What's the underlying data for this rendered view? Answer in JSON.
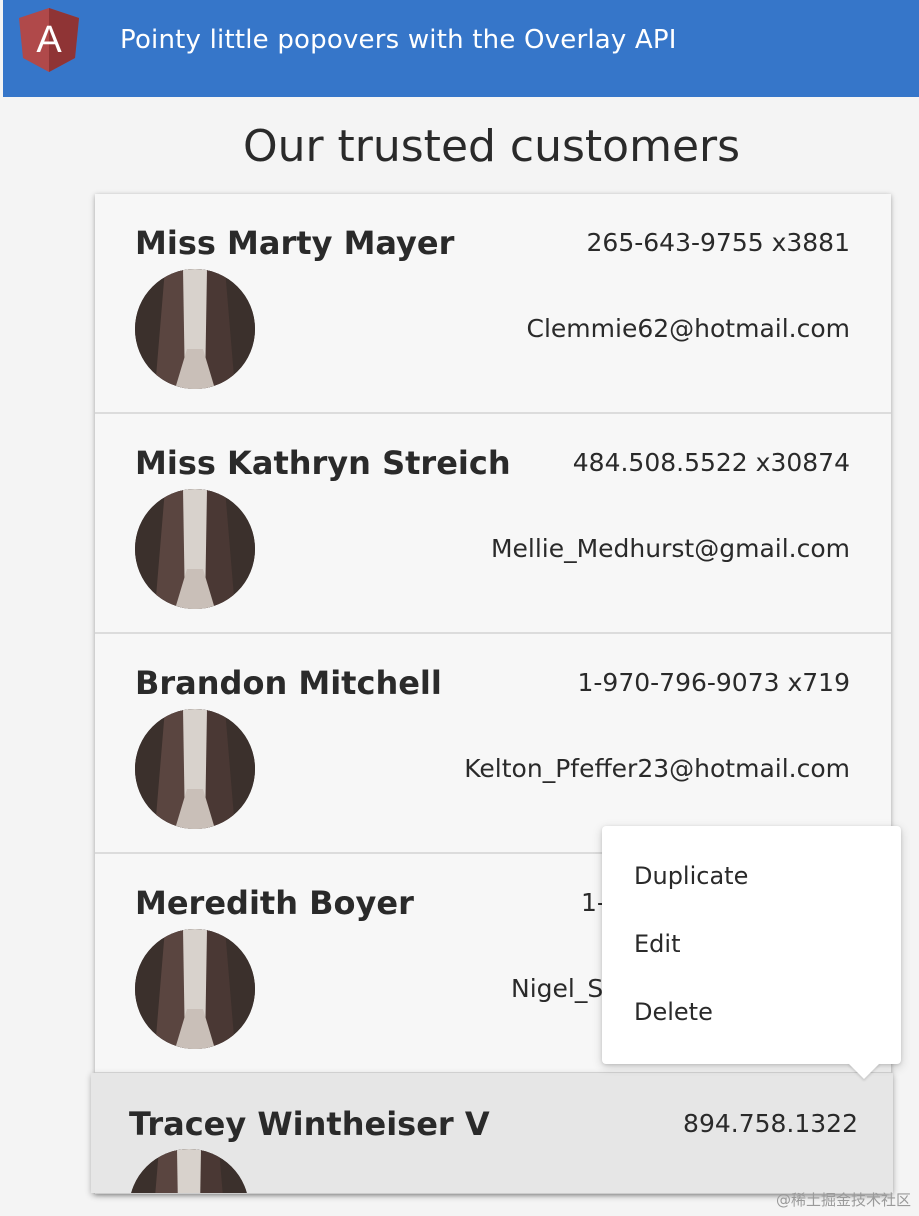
{
  "toolbar": {
    "title": "Pointy little popovers with the Overlay API",
    "logo_letter": "A",
    "logo_icon": "angular-logo-icon",
    "color": "#3676c9"
  },
  "page": {
    "title": "Our trusted customers"
  },
  "customers": [
    {
      "name": "Miss Marty Mayer",
      "phone": "265-643-9755 x3881",
      "email": "Clemmie62@hotmail.com"
    },
    {
      "name": "Miss Kathryn Streich",
      "phone": "484.508.5522 x30874",
      "email": "Mellie_Medhurst@gmail.com"
    },
    {
      "name": "Brandon Mitchell",
      "phone": "1-970-796-9073 x719",
      "email": "Kelton_Pfeffer23@hotmail.com"
    },
    {
      "name": "Meredith Boyer",
      "phone_visible": "1-",
      "email_visible": "Nigel_S"
    },
    {
      "name": "Tracey Wintheiser V",
      "phone": "894.758.1322"
    }
  ],
  "popover": {
    "items": [
      {
        "label": "Duplicate"
      },
      {
        "label": "Edit"
      },
      {
        "label": "Delete"
      }
    ]
  },
  "watermark": "@稀土掘金技术社区"
}
